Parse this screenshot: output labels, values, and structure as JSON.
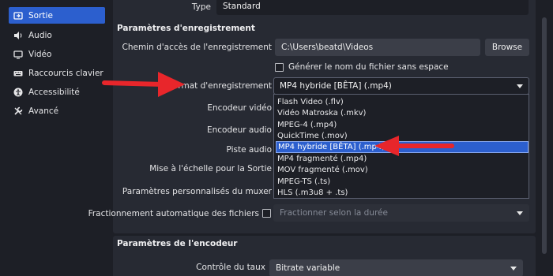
{
  "sidebar": {
    "items": [
      {
        "label": "Sortie",
        "icon": "output-icon",
        "active": true
      },
      {
        "label": "Audio",
        "icon": "speaker-icon",
        "active": false
      },
      {
        "label": "Vidéo",
        "icon": "monitor-icon",
        "active": false
      },
      {
        "label": "Raccourcis clavier",
        "icon": "keyboard-icon",
        "active": false
      },
      {
        "label": "Accessibilité",
        "icon": "accessibility-icon",
        "active": false
      },
      {
        "label": "Avancé",
        "icon": "wrench-icon",
        "active": false
      }
    ]
  },
  "header": {
    "type_label": "Type",
    "type_value": "Standard"
  },
  "recording": {
    "section_title": "Paramètres d'enregistrement",
    "path_label": "Chemin d'accès de l'enregistrement",
    "path_value": "C:\\Users\\beatd\\Videos",
    "browse_label": "Browse",
    "no_space_label": "Générer le nom du fichier sans espace",
    "format_label": "Format d'enregistrement",
    "format_value": "MP4 hybride [BÊTA] (.mp4)",
    "video_encoder_label": "Encodeur vidéo",
    "audio_encoder_label": "Encodeur audio",
    "audio_track_label": "Piste audio",
    "rescale_label": "Mise à l'échelle pour la Sortie",
    "muxer_label": "Paramètres personnalisés du muxer",
    "split_label": "Fractionnement automatique des fichiers",
    "split_value": "Fractionner selon la durée"
  },
  "format_options": [
    "Flash Video (.flv)",
    "Vidéo Matroska (.mkv)",
    "MPEG-4 (.mp4)",
    "QuickTime (.mov)",
    "MP4 hybride [BÊTA] (.mp4)",
    "MP4 fragmenté (.mp4)",
    "MOV fragmenté (.mov)",
    "MPEG-TS (.ts)",
    "HLS (.m3u8 + .ts)"
  ],
  "encoder": {
    "section_title": "Paramètres de l'encodeur",
    "rate_control_label": "Contrôle du taux",
    "rate_control_value": "Bitrate variable"
  },
  "colors": {
    "accent": "#2c5fce",
    "annotation": "#e8262b"
  }
}
